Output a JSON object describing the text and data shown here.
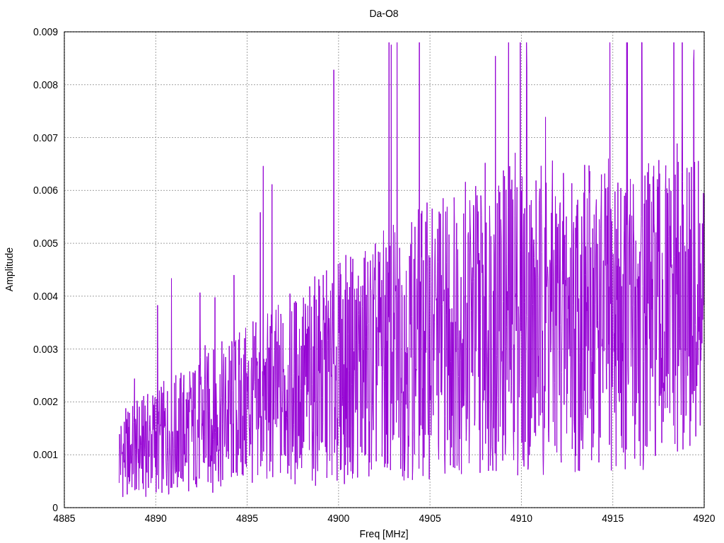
{
  "plot": {
    "title": "Da-O8",
    "xlabel": "Freq [MHz]",
    "ylabel": "Amplitude",
    "xticks": [
      "4885",
      "4890",
      "4895",
      "4900",
      "4905",
      "4910",
      "4915",
      "4920"
    ],
    "yticks": [
      "0.009",
      "0.008",
      "0.007",
      "0.006",
      "0.005",
      "0.004",
      "0.003",
      "0.002",
      "0.001",
      "0"
    ]
  }
}
